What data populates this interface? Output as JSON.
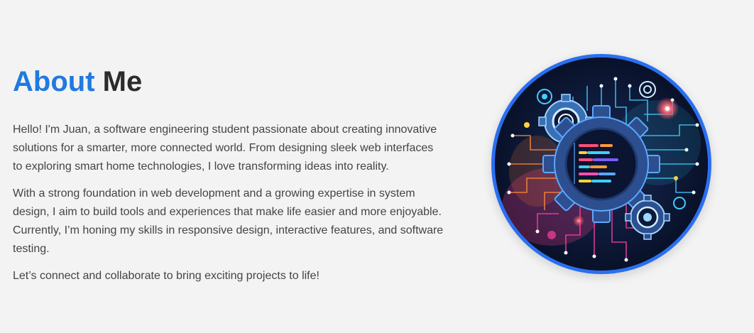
{
  "about": {
    "title_accent": "About",
    "title_rest": "Me",
    "paragraphs": [
      "Hello! I'm Juan, a software engineering student passionate about creating innovative solutions for a smarter, more connected world. From designing sleek web interfaces to exploring smart home technologies, I love transforming ideas into reality.",
      "With a strong foundation in web development and a growing expertise in system design, I aim to build tools and experiences that make life easier and more enjoyable. Currently, I’m honing my skills in responsive design, interactive features, and software testing.",
      "Let’s connect and collaborate to bring exciting projects to life!"
    ],
    "image": {
      "icon": "gear-code-circuit-illustration",
      "border_color": "#2a6ff0"
    }
  },
  "colors": {
    "accent": "#1f7ae0",
    "title": "#2b2b2b",
    "body_text": "#444444",
    "background": "#f3f3f3"
  }
}
